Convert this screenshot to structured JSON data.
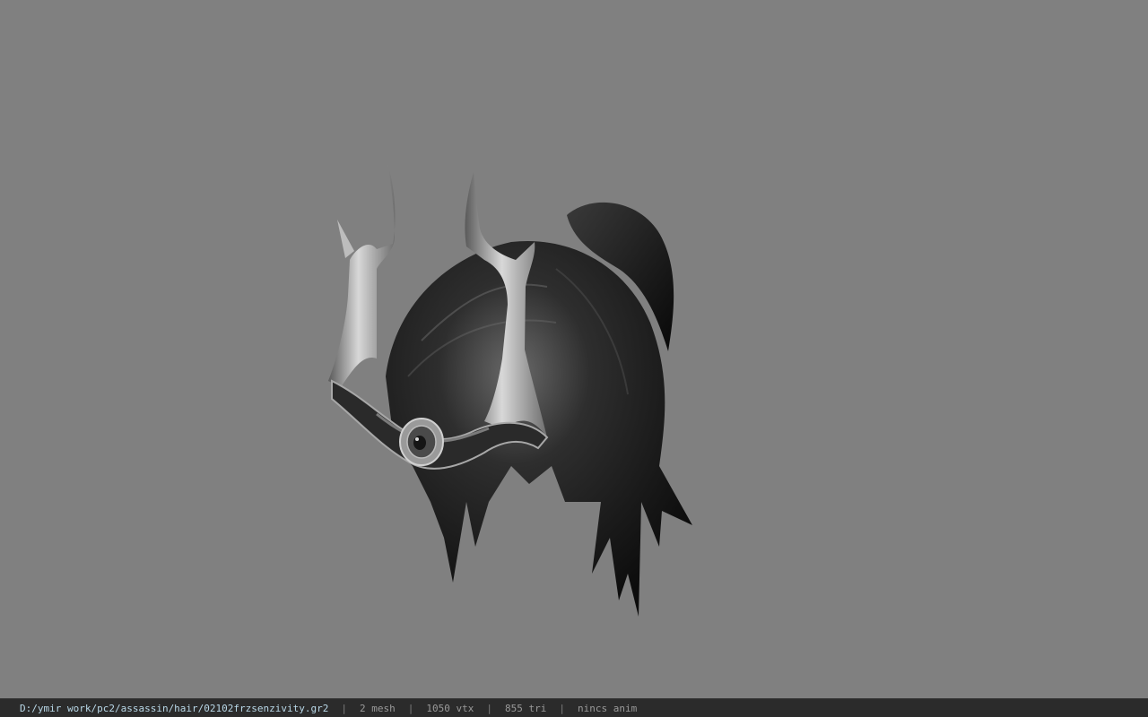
{
  "status": {
    "file_path": "D:/ymir work/pc2/assassin/hair/02102frzsenzivity.gr2",
    "separator": "|",
    "mesh": "2 mesh",
    "vertices": "1050 vtx",
    "triangles": "855 tri",
    "animation": "nincs anim"
  },
  "colors": {
    "viewport_background": "#808080",
    "statusbar_background": "#2b2b2b",
    "path_text": "#b9d8e8",
    "info_text": "#9a9a9a"
  }
}
